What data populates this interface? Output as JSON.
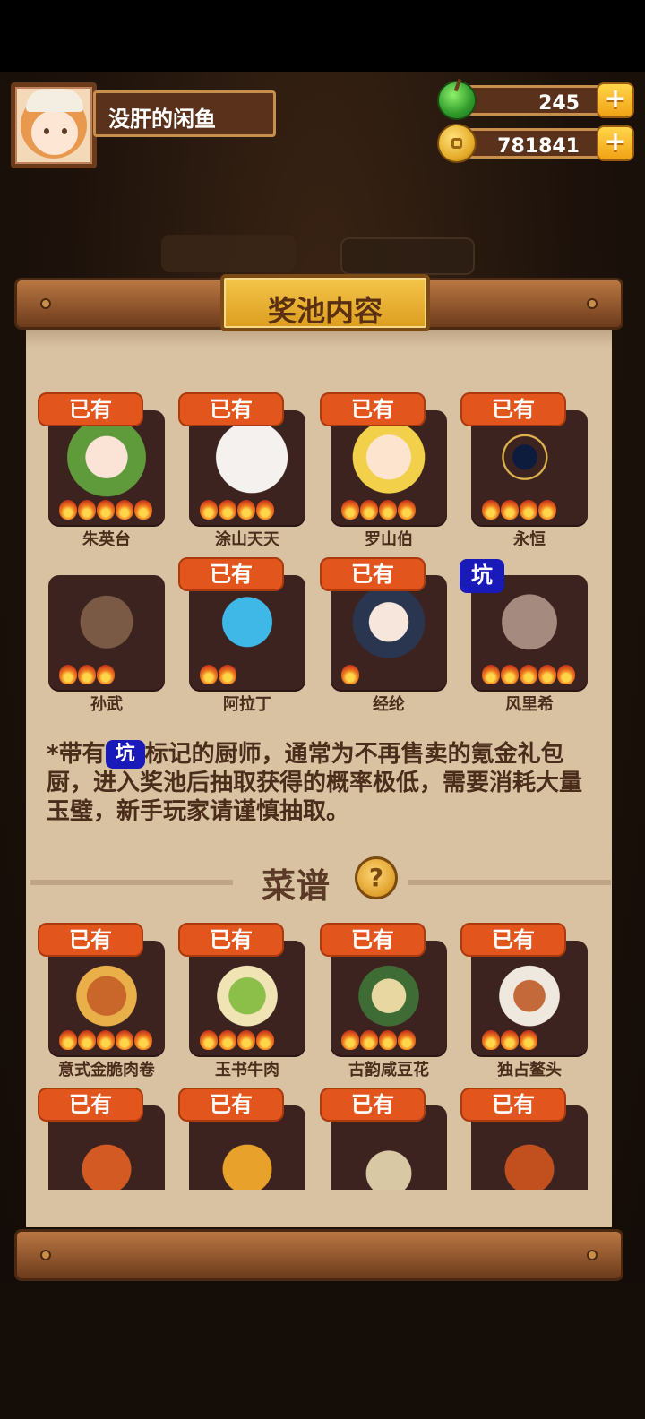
{
  "player": {
    "name": "没肝的闲鱼"
  },
  "resources": {
    "gems": "245",
    "coins": "781841",
    "plus_symbol": "+"
  },
  "panel": {
    "title": "奖池内容"
  },
  "tags": {
    "owned": "已有",
    "pit": "坑"
  },
  "chefs": [
    {
      "name": "朱英台",
      "owned": true,
      "pit": false,
      "rarity": 5
    },
    {
      "name": "涂山天天",
      "owned": true,
      "pit": false,
      "rarity": 4
    },
    {
      "name": "罗山伯",
      "owned": true,
      "pit": false,
      "rarity": 4
    },
    {
      "name": "永恒",
      "owned": true,
      "pit": false,
      "rarity": 4
    },
    {
      "name": "孙武",
      "owned": false,
      "pit": false,
      "rarity": 3
    },
    {
      "name": "阿拉丁",
      "owned": true,
      "pit": false,
      "rarity": 2
    },
    {
      "name": "经纶",
      "owned": true,
      "pit": false,
      "rarity": 1
    },
    {
      "name": "风里希",
      "owned": false,
      "pit": true,
      "rarity": 5
    }
  ],
  "note": {
    "prefix": "*带有",
    "suffix": "标记的厨师，通常为不再售卖的氪金礼包厨，进入奖池后抽取获得的概率极低，需要消耗大量玉璧，新手玩家请谨慎抽取。"
  },
  "recipes_section": {
    "title": "菜谱",
    "help": "?"
  },
  "recipes": [
    {
      "name": "意式金脆肉卷",
      "owned": true,
      "rarity": 5
    },
    {
      "name": "玉书牛肉",
      "owned": true,
      "rarity": 4
    },
    {
      "name": "古韵咸豆花",
      "owned": true,
      "rarity": 4
    },
    {
      "name": "独占鳌头",
      "owned": true,
      "rarity": 3
    },
    {
      "name": "",
      "owned": true,
      "rarity": 0
    },
    {
      "name": "",
      "owned": true,
      "rarity": 0
    },
    {
      "name": "",
      "owned": true,
      "rarity": 0
    },
    {
      "name": "",
      "owned": true,
      "rarity": 0
    }
  ],
  "colors": {
    "owned_tag": "#e2561d",
    "pit_tag": "#1a1ab8",
    "paper": "#d9c2a2",
    "card": "#3c2320"
  }
}
